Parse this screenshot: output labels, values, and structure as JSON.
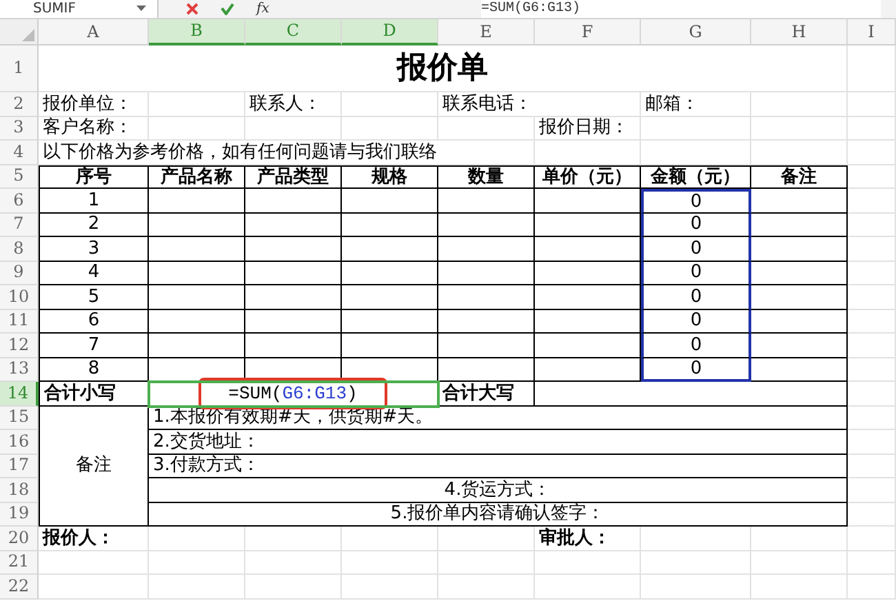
{
  "formula_bar": {
    "name_box": "SUMIF",
    "function_label": "fx",
    "formula": "=SUM(G6:G13)"
  },
  "column_headers": [
    {
      "label": "A",
      "selected": false
    },
    {
      "label": "B",
      "selected": true
    },
    {
      "label": "C",
      "selected": true
    },
    {
      "label": "D",
      "selected": true
    },
    {
      "label": "E",
      "selected": false
    },
    {
      "label": "F",
      "selected": false
    },
    {
      "label": "G",
      "selected": false
    },
    {
      "label": "H",
      "selected": false
    },
    {
      "label": "I",
      "selected": false
    }
  ],
  "rows": [
    {
      "label": "1",
      "selected": false,
      "cells": [
        {
          "kind": "title",
          "text": "报价单"
        }
      ]
    },
    {
      "label": "2",
      "selected": false,
      "cells": [
        {
          "kind": "label",
          "text": "报价单位："
        },
        {
          "kind": "label",
          "text": "联系人："
        },
        {
          "kind": "label",
          "text": "联系电话："
        },
        {
          "kind": "label",
          "text": "邮箱："
        }
      ]
    },
    {
      "label": "3",
      "selected": false,
      "cells": [
        {
          "kind": "label",
          "text": "客户名称："
        },
        {
          "kind": "label",
          "text": "报价日期："
        }
      ]
    },
    {
      "label": "4",
      "selected": false,
      "cells": [
        {
          "kind": "label",
          "text": "以下价格为参考价格，如有任何问题请与我们联络"
        }
      ]
    },
    {
      "label": "5",
      "selected": false,
      "cells": [
        {
          "kind": "heading",
          "text": "序号"
        },
        {
          "kind": "heading",
          "text": "产品名称"
        },
        {
          "kind": "heading",
          "text": "产品类型"
        },
        {
          "kind": "heading",
          "text": "规格"
        },
        {
          "kind": "heading",
          "text": "数量"
        },
        {
          "kind": "heading",
          "text": "单价（元）"
        },
        {
          "kind": "heading",
          "text": "金额（元）"
        },
        {
          "kind": "heading",
          "text": "备注"
        }
      ]
    },
    {
      "label": "6",
      "selected": false,
      "cells": [
        {
          "kind": "centered",
          "text": "1"
        },
        {
          "kind": "centered",
          "text": "0"
        }
      ]
    },
    {
      "label": "7",
      "selected": false,
      "cells": [
        {
          "kind": "centered",
          "text": "2"
        },
        {
          "kind": "centered",
          "text": "0"
        }
      ]
    },
    {
      "label": "8",
      "selected": false,
      "cells": [
        {
          "kind": "centered",
          "text": "3"
        },
        {
          "kind": "centered",
          "text": "0"
        }
      ]
    },
    {
      "label": "9",
      "selected": false,
      "cells": [
        {
          "kind": "centered",
          "text": "4"
        },
        {
          "kind": "centered",
          "text": "0"
        }
      ]
    },
    {
      "label": "10",
      "selected": false,
      "cells": [
        {
          "kind": "centered",
          "text": "5"
        },
        {
          "kind": "centered",
          "text": "0"
        }
      ]
    },
    {
      "label": "11",
      "selected": false,
      "cells": [
        {
          "kind": "centered",
          "text": "6"
        },
        {
          "kind": "centered",
          "text": "0"
        }
      ]
    },
    {
      "label": "12",
      "selected": false,
      "cells": [
        {
          "kind": "centered",
          "text": "7"
        },
        {
          "kind": "centered",
          "text": "0"
        }
      ]
    },
    {
      "label": "13",
      "selected": false,
      "cells": [
        {
          "kind": "centered",
          "text": "8"
        },
        {
          "kind": "centered",
          "text": "0"
        }
      ]
    },
    {
      "label": "14",
      "selected": true,
      "cells": [
        {
          "kind": "strong",
          "text": "合计小写"
        },
        {
          "kind": "formula",
          "active": true,
          "highlighted": true,
          "prefix": "=SUM(",
          "range": "G6:G13",
          "suffix": ")"
        },
        {
          "kind": "strong",
          "text": "合计大写"
        },
        {
          "kind": "blank"
        }
      ]
    },
    {
      "label": "15",
      "selected": false,
      "cells": [
        {
          "kind": "centered",
          "text": "备注"
        },
        {
          "kind": "label",
          "text": "1.本报价有效期#天，供货期#天。"
        }
      ]
    },
    {
      "label": "16",
      "selected": false,
      "cells": [
        {
          "kind": "label",
          "text": "2.交货地址："
        }
      ]
    },
    {
      "label": "17",
      "selected": false,
      "cells": [
        {
          "kind": "label",
          "text": "3.付款方式："
        }
      ]
    },
    {
      "label": "18",
      "selected": false,
      "cells": [
        {
          "kind": "centered",
          "text": "4.货运方式："
        }
      ]
    },
    {
      "label": "19",
      "selected": false,
      "cells": [
        {
          "kind": "centered",
          "text": "5.报价单内容请确认签字："
        }
      ]
    },
    {
      "label": "20",
      "selected": false,
      "cells": [
        {
          "kind": "strong",
          "text": "报价人："
        },
        {
          "kind": "strong",
          "text": "审批人："
        }
      ]
    },
    {
      "label": "21",
      "selected": false
    },
    {
      "label": "22",
      "selected": false
    }
  ]
}
